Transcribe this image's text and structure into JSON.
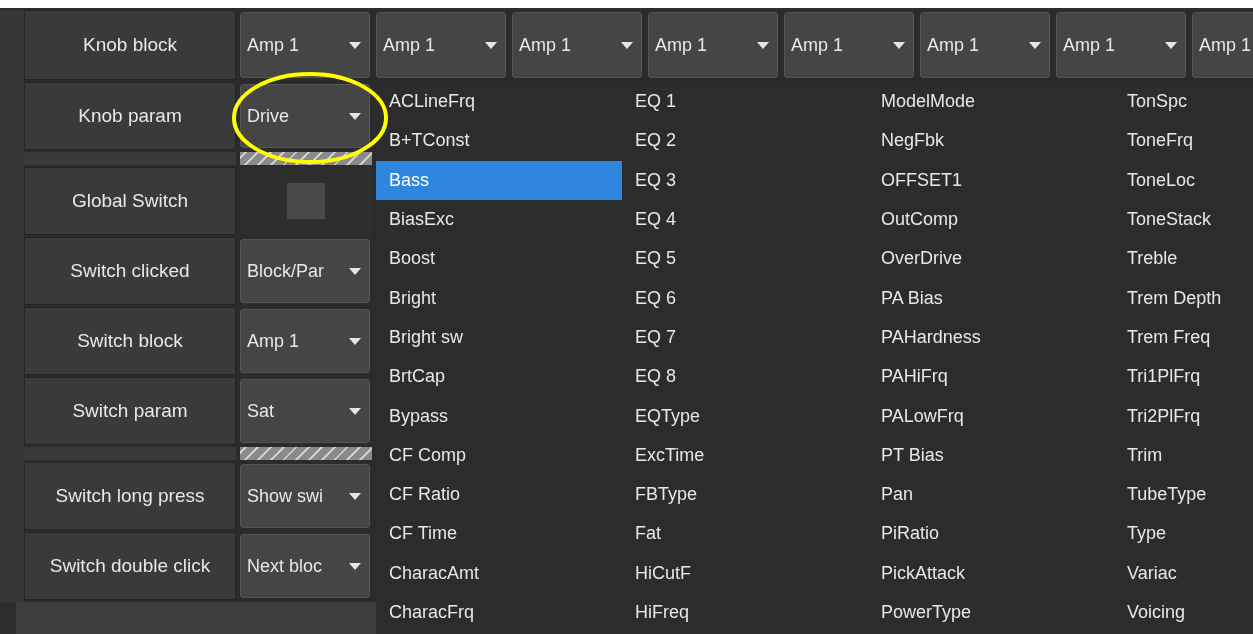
{
  "top_row": {
    "label": "Knob block",
    "dropdowns": [
      "Amp 1",
      "Amp 1",
      "Amp 1",
      "Amp 1",
      "Amp 1",
      "Amp 1",
      "Amp 1",
      "Amp 1"
    ]
  },
  "rows": [
    {
      "kind": "dropdown",
      "label": "Knob param",
      "value": "Drive"
    },
    {
      "kind": "separator"
    },
    {
      "kind": "checkbox",
      "label": "Global Switch",
      "checked": false
    },
    {
      "kind": "dropdown",
      "label": "Switch clicked",
      "value": "Block/Par"
    },
    {
      "kind": "dropdown",
      "label": "Switch block",
      "value": "Amp 1"
    },
    {
      "kind": "dropdown",
      "label": "Switch param",
      "value": "Sat"
    },
    {
      "kind": "separator"
    },
    {
      "kind": "dropdown",
      "label": "Switch long press",
      "value": "Show swi"
    },
    {
      "kind": "dropdown",
      "label": "Switch double click",
      "value": "Next bloc"
    }
  ],
  "popup_options": [
    {
      "label": "ACLineFrq",
      "selected": false
    },
    {
      "label": "B+TConst",
      "selected": false
    },
    {
      "label": "Bass",
      "selected": true
    },
    {
      "label": "BiasExc",
      "selected": false
    },
    {
      "label": "Boost",
      "selected": false
    },
    {
      "label": "Bright",
      "selected": false
    },
    {
      "label": "Bright sw",
      "selected": false
    },
    {
      "label": "BrtCap",
      "selected": false
    },
    {
      "label": "Bypass",
      "selected": false
    },
    {
      "label": "CF Comp",
      "selected": false
    },
    {
      "label": "CF Ratio",
      "selected": false
    },
    {
      "label": "CF Time",
      "selected": false
    },
    {
      "label": "CharacAmt",
      "selected": false
    },
    {
      "label": "CharacFrq",
      "selected": false
    },
    {
      "label": "EQ 1",
      "selected": false
    },
    {
      "label": "EQ 2",
      "selected": false
    },
    {
      "label": "EQ 3",
      "selected": false
    },
    {
      "label": "EQ 4",
      "selected": false
    },
    {
      "label": "EQ 5",
      "selected": false
    },
    {
      "label": "EQ 6",
      "selected": false
    },
    {
      "label": "EQ 7",
      "selected": false
    },
    {
      "label": "EQ 8",
      "selected": false
    },
    {
      "label": "EQType",
      "selected": false
    },
    {
      "label": "ExcTime",
      "selected": false
    },
    {
      "label": "FBType",
      "selected": false
    },
    {
      "label": "Fat",
      "selected": false
    },
    {
      "label": "HiCutF",
      "selected": false
    },
    {
      "label": "HiFreq",
      "selected": false
    },
    {
      "label": "ModelMode",
      "selected": false
    },
    {
      "label": "NegFbk",
      "selected": false
    },
    {
      "label": "OFFSET1",
      "selected": false
    },
    {
      "label": "OutComp",
      "selected": false
    },
    {
      "label": "OverDrive",
      "selected": false
    },
    {
      "label": "PA Bias",
      "selected": false
    },
    {
      "label": "PAHardness",
      "selected": false
    },
    {
      "label": "PAHiFrq",
      "selected": false
    },
    {
      "label": "PALowFrq",
      "selected": false
    },
    {
      "label": "PT Bias",
      "selected": false
    },
    {
      "label": "Pan",
      "selected": false
    },
    {
      "label": "PiRatio",
      "selected": false
    },
    {
      "label": "PickAttack",
      "selected": false
    },
    {
      "label": "PowerType",
      "selected": false
    },
    {
      "label": "TonSpc",
      "selected": false
    },
    {
      "label": "ToneFrq",
      "selected": false
    },
    {
      "label": "ToneLoc",
      "selected": false
    },
    {
      "label": "ToneStack",
      "selected": false
    },
    {
      "label": "Treble",
      "selected": false
    },
    {
      "label": "Trem Depth",
      "selected": false
    },
    {
      "label": "Trem Freq",
      "selected": false
    },
    {
      "label": "Tri1PlFrq",
      "selected": false
    },
    {
      "label": "Tri2PlFrq",
      "selected": false
    },
    {
      "label": "Trim",
      "selected": false
    },
    {
      "label": "TubeType",
      "selected": false
    },
    {
      "label": "Type",
      "selected": false
    },
    {
      "label": "Variac",
      "selected": false
    },
    {
      "label": "Voicing",
      "selected": false
    }
  ]
}
